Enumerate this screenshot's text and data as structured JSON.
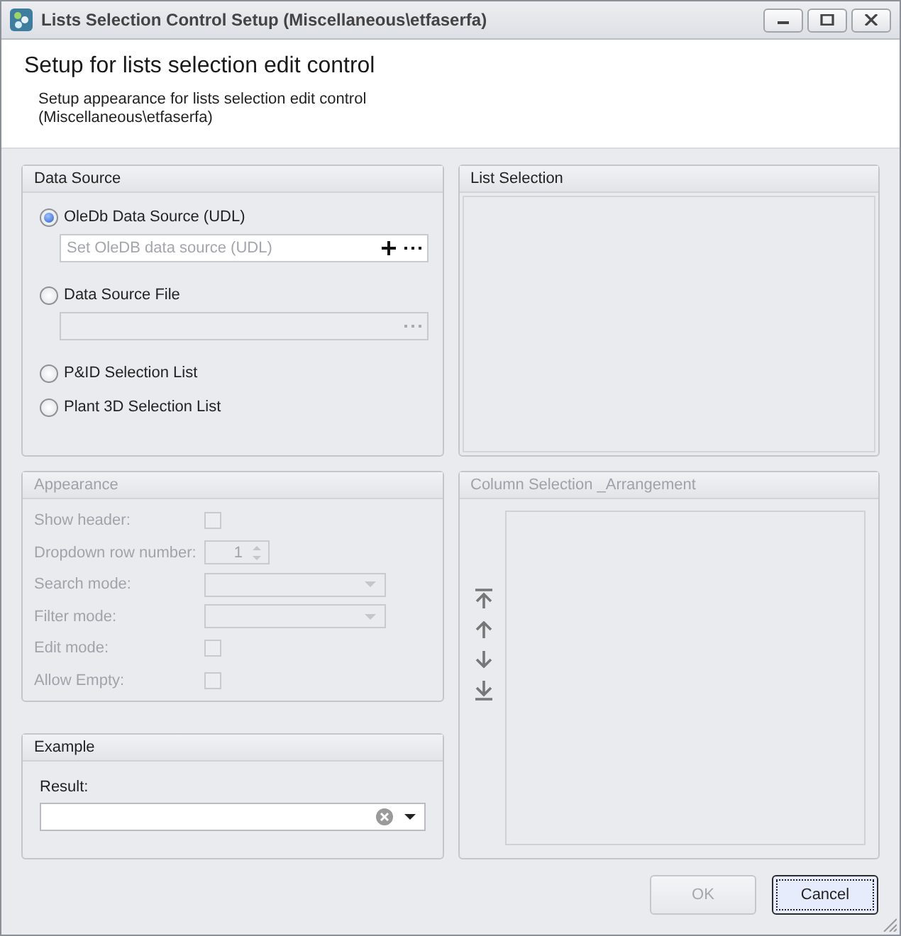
{
  "window": {
    "title": "Lists Selection Control Setup (Miscellaneous\\etfaserfa)"
  },
  "header": {
    "title": "Setup for lists selection edit control",
    "subtitle": "Setup appearance for lists selection edit control (Miscellaneous\\etfaserfa)"
  },
  "data_source": {
    "title": "Data Source",
    "options": [
      {
        "label": "OleDb Data Source (UDL)",
        "selected": true,
        "field": {
          "placeholder": "Set OleDB data source (UDL)",
          "enabled": true
        }
      },
      {
        "label": "Data Source File",
        "selected": false,
        "field": {
          "enabled": false
        }
      },
      {
        "label": "P&ID Selection List",
        "selected": false
      },
      {
        "label": "Plant 3D Selection List",
        "selected": false
      }
    ]
  },
  "appearance": {
    "title": "Appearance",
    "disabled": true,
    "rows": [
      {
        "label": "Show header:",
        "kind": "checkbox",
        "checked": false
      },
      {
        "label": "Dropdown row number:",
        "kind": "spin",
        "value": "1"
      },
      {
        "label": "Search mode:",
        "kind": "combo"
      },
      {
        "label": "Filter mode:",
        "kind": "combo"
      },
      {
        "label": "Edit mode:",
        "kind": "checkbox",
        "checked": false
      },
      {
        "label": "Allow Empty:",
        "kind": "checkbox",
        "checked": false
      }
    ]
  },
  "example": {
    "title": "Example",
    "result_label": "Result:"
  },
  "list_selection": {
    "title": "List Selection"
  },
  "column_selection": {
    "title": "Column Selection _Arrangement",
    "disabled": true
  },
  "buttons": [
    {
      "label": "OK",
      "disabled": true,
      "focused": false
    },
    {
      "label": "Cancel",
      "disabled": false,
      "focused": true
    }
  ]
}
